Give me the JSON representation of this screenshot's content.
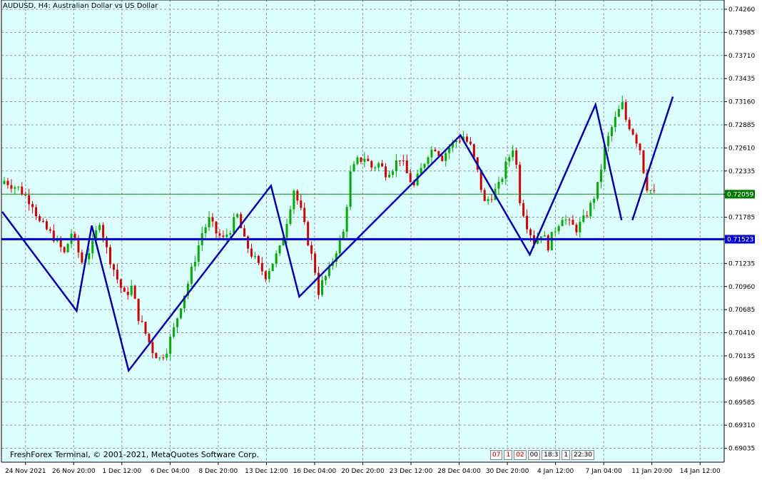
{
  "title": "AUDUSD, H4:  Australian Dollar vs US Dollar",
  "footer": "FreshForex Terminal, © 2001-2021, MetaQuotes Software Corp.",
  "nav_widget": [
    "07",
    "1",
    "02",
    "00",
    "18:3",
    "1",
    "22:30"
  ],
  "colors": {
    "background": "#ddffff",
    "grid": "#8a9a9a",
    "candle_up": "#00aa00",
    "candle_down": "#cc0000",
    "zigzag": "#0000aa",
    "support_line": "#0000cc",
    "bid_line": "#228822",
    "bid_label_bg": "#007700",
    "support_label_bg": "#0000cc"
  },
  "chart_data": {
    "type": "candlestick",
    "symbol": "AUDUSD",
    "timeframe": "H4",
    "y_ticks": [
      "0.74260",
      "0.73985",
      "0.73710",
      "0.73435",
      "0.73160",
      "0.72885",
      "0.72610",
      "0.72335",
      "0.72059",
      "0.71785",
      "0.71523",
      "0.71235",
      "0.70960",
      "0.70685",
      "0.70410",
      "0.70135",
      "0.69860",
      "0.69585",
      "0.69310",
      "0.69035"
    ],
    "ylim": [
      0.6887,
      0.7437
    ],
    "x_ticks": [
      "24 Nov 2021",
      "26 Nov 20:00",
      "1 Dec 12:00",
      "6 Dec 04:00",
      "8 Dec 20:00",
      "13 Dec 12:00",
      "16 Dec 04:00",
      "20 Dec 20:00",
      "23 Dec 12:00",
      "28 Dec 04:00",
      "30 Dec 20:00",
      "4 Jan 12:00",
      "7 Jan 04:00",
      "11 Jan 20:00",
      "14 Jan 12:00"
    ],
    "current_price": "0.72059",
    "support_level": "0.71523",
    "close_path": [
      [
        0,
        0.7222
      ],
      [
        4,
        0.7213
      ],
      [
        8,
        0.7195
      ],
      [
        10,
        0.7172
      ],
      [
        14,
        0.7155
      ],
      [
        17,
        0.7135
      ],
      [
        19,
        0.716
      ],
      [
        22,
        0.7125
      ],
      [
        25,
        0.7145
      ],
      [
        27,
        0.7175
      ],
      [
        29,
        0.714
      ],
      [
        32,
        0.7105
      ],
      [
        34,
        0.7085
      ],
      [
        36,
        0.7095
      ],
      [
        38,
        0.706
      ],
      [
        40,
        0.704
      ],
      [
        42,
        0.702
      ],
      [
        44,
        0.701
      ],
      [
        46,
        0.7022
      ],
      [
        48,
        0.7045
      ],
      [
        50,
        0.7075
      ],
      [
        52,
        0.71
      ],
      [
        54,
        0.713
      ],
      [
        56,
        0.716
      ],
      [
        58,
        0.7175
      ],
      [
        60,
        0.716
      ],
      [
        62,
        0.7152
      ],
      [
        64,
        0.7165
      ],
      [
        66,
        0.718
      ],
      [
        68,
        0.715
      ],
      [
        70,
        0.7135
      ],
      [
        72,
        0.712
      ],
      [
        74,
        0.711
      ],
      [
        76,
        0.7125
      ],
      [
        78,
        0.714
      ],
      [
        80,
        0.7175
      ],
      [
        82,
        0.7212
      ],
      [
        84,
        0.7185
      ],
      [
        86,
        0.715
      ],
      [
        88,
        0.7115
      ],
      [
        89,
        0.709
      ],
      [
        90,
        0.71
      ],
      [
        92,
        0.7115
      ],
      [
        94,
        0.714
      ],
      [
        96,
        0.716
      ],
      [
        98,
        0.723
      ],
      [
        100,
        0.7245
      ],
      [
        102,
        0.725
      ],
      [
        104,
        0.7238
      ],
      [
        106,
        0.7242
      ],
      [
        108,
        0.7232
      ],
      [
        110,
        0.7238
      ],
      [
        112,
        0.725
      ],
      [
        114,
        0.723
      ],
      [
        116,
        0.7215
      ],
      [
        118,
        0.7235
      ],
      [
        120,
        0.7255
      ],
      [
        122,
        0.7262
      ],
      [
        124,
        0.725
      ],
      [
        126,
        0.7262
      ],
      [
        128,
        0.727
      ],
      [
        130,
        0.7275
      ],
      [
        132,
        0.7262
      ],
      [
        134,
        0.7232
      ],
      [
        136,
        0.7195
      ],
      [
        138,
        0.7205
      ],
      [
        140,
        0.7215
      ],
      [
        142,
        0.724
      ],
      [
        144,
        0.7262
      ],
      [
        145,
        0.724
      ],
      [
        146,
        0.72
      ],
      [
        148,
        0.717
      ],
      [
        150,
        0.715
      ],
      [
        152,
        0.716
      ],
      [
        154,
        0.7145
      ],
      [
        156,
        0.7165
      ],
      [
        158,
        0.718
      ],
      [
        160,
        0.717
      ],
      [
        162,
        0.7165
      ],
      [
        164,
        0.7175
      ],
      [
        166,
        0.7192
      ],
      [
        168,
        0.7215
      ],
      [
        170,
        0.726
      ],
      [
        172,
        0.7285
      ],
      [
        174,
        0.7305
      ],
      [
        175,
        0.7312
      ],
      [
        176,
        0.7295
      ],
      [
        178,
        0.728
      ],
      [
        180,
        0.726
      ],
      [
        181,
        0.7235
      ],
      [
        182,
        0.7215
      ],
      [
        184,
        0.7206
      ]
    ],
    "zigzag": [
      [
        0.001,
        0.7185
      ],
      [
        0.104,
        0.7067
      ],
      [
        0.125,
        0.71685
      ],
      [
        0.176,
        0.6996
      ],
      [
        0.373,
        0.7216
      ],
      [
        0.412,
        0.7084
      ],
      [
        0.635,
        0.7276
      ],
      [
        0.731,
        0.7134
      ],
      [
        0.822,
        0.73125
      ],
      [
        0.858,
        0.7175
      ]
    ],
    "zigzag_projection": [
      [
        0.873,
        0.7175
      ],
      [
        0.929,
        0.7322
      ]
    ]
  }
}
